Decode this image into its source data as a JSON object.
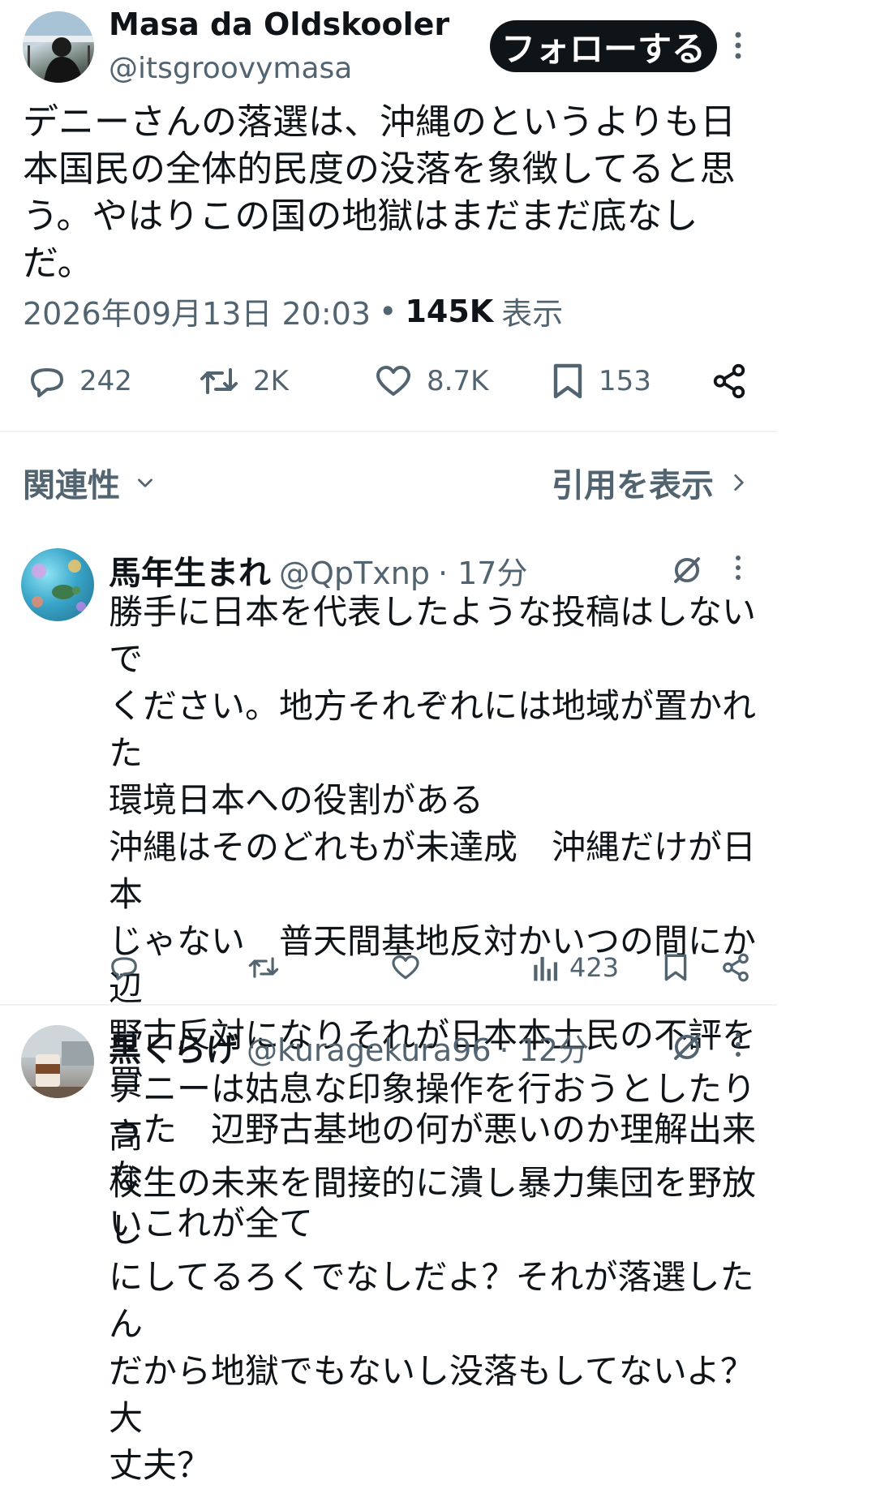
{
  "tweet": {
    "author_name": "Masa da Oldskooler",
    "author_handle": "@itsgroovymasa",
    "follow_label": "フォローする",
    "text": "デニーさんの落選は、沖縄のというよりも日\n本国民の全体的民度の没落を象徴してると思\nう。やはりこの国の地獄はまだまだ底なし\nだ。",
    "timestamp": "2026年09月13日 20:03",
    "views_count": "145K",
    "views_label": "表示",
    "separator": "•",
    "stats": {
      "replies": "242",
      "retweets": "2K",
      "likes": "8.7K",
      "bookmarks": "153"
    }
  },
  "filter": {
    "sort_label": "関連性",
    "quotes_label": "引用を表示"
  },
  "replies": [
    {
      "name": "馬年生まれ",
      "handle": "@QpTxnp",
      "time": "· 17分",
      "text": "勝手に日本を代表したような投稿はしないで\nください。地方それぞれには地域が置かれた\n環境日本への役割がある\n沖縄はそのどれもが未達成　沖縄だけが日本\nじゃない　普天間基地反対かいつの間にか辺\n野古反対になりそれが日本本土民の不評を買\nった　辺野古基地の何が悪いのか理解出来な\nいこれが全て",
      "views": "423"
    },
    {
      "name": "黒くらげ",
      "handle": "@kuragekura96",
      "time": "· 12分",
      "text": "デニーは姑息な印象操作を行おうとしたり高\n校生の未来を間接的に潰し暴力集団を野放し\nにしてるろくでなしだよ？それが落選したん\nだから地獄でもないし没落もしてないよ？大\n丈夫？"
    }
  ],
  "icons": {
    "more": "more-dots-icon",
    "reply": "speech-bubble-icon",
    "retweet": "retweet-icon",
    "like": "heart-icon",
    "bookmark": "bookmark-icon",
    "share": "share-icon",
    "views": "bar-chart-icon",
    "grok": "grok-slash-icon",
    "chevron_down": "chevron-down-icon",
    "chevron_right": "chevron-right-icon"
  },
  "colors": {
    "text": "#0f1419",
    "muted": "#536471",
    "divider": "#eff3f4",
    "follow_bg": "#0f1419"
  }
}
